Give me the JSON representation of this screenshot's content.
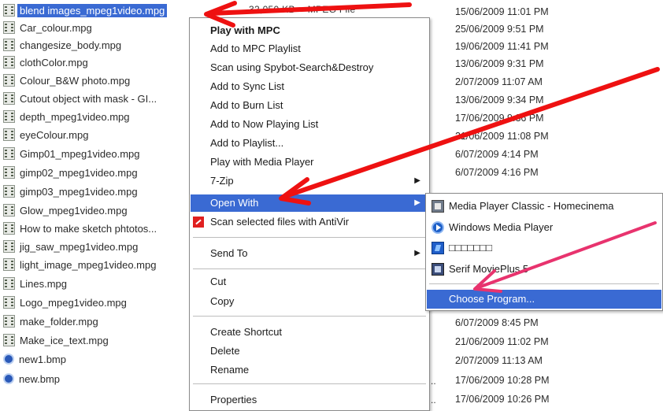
{
  "files": [
    {
      "name": "blend images_mpeg1video.mpg",
      "type": "mpg",
      "selected": true
    },
    {
      "name": "Car_colour.mpg",
      "type": "mpg"
    },
    {
      "name": "changesize_body.mpg",
      "type": "mpg"
    },
    {
      "name": "clothColor.mpg",
      "type": "mpg"
    },
    {
      "name": "Colour_B&W photo.mpg",
      "type": "mpg"
    },
    {
      "name": "Cutout object with mask - GI...",
      "type": "mpg"
    },
    {
      "name": "depth_mpeg1video.mpg",
      "type": "mpg"
    },
    {
      "name": "eyeColour.mpg",
      "type": "mpg"
    },
    {
      "name": "Gimp01_mpeg1video.mpg",
      "type": "mpg"
    },
    {
      "name": "gimp02_mpeg1video.mpg",
      "type": "mpg"
    },
    {
      "name": "gimp03_mpeg1video.mpg",
      "type": "mpg"
    },
    {
      "name": "Glow_mpeg1video.mpg",
      "type": "mpg"
    },
    {
      "name": "How to make  sketch phtotos...",
      "type": "mpg"
    },
    {
      "name": "jig_saw_mpeg1video.mpg",
      "type": "mpg"
    },
    {
      "name": "light_image_mpeg1video.mpg",
      "type": "mpg"
    },
    {
      "name": "Lines.mpg",
      "type": "mpg"
    },
    {
      "name": "Logo_mpeg1video.mpg",
      "type": "mpg"
    },
    {
      "name": "make_folder.mpg",
      "type": "mpg"
    },
    {
      "name": "Make_ice_text.mpg",
      "type": "mpg"
    },
    {
      "name": "new1.bmp",
      "type": "bmp"
    },
    {
      "name": "new.bmp",
      "type": "bmp"
    }
  ],
  "selected_size": "32,050 KB",
  "selected_type": "MPEG File",
  "dates": [
    "15/06/2009 11:01 PM",
    "25/06/2009 9:51 PM",
    "19/06/2009 11:41 PM",
    "13/06/2009 9:31 PM",
    "2/07/2009 11:07 AM",
    "13/06/2009 9:34 PM",
    "17/06/2009 9:36 PM",
    "21/06/2009 11:08 PM",
    "6/07/2009 4:14 PM",
    "6/07/2009 4:16 PM",
    "6/07/2009 8:45 PM",
    "21/06/2009 11:02 PM",
    "2/07/2009 11:13 AM",
    "17/06/2009 10:28 PM",
    "17/06/2009 10:26 PM"
  ],
  "ellipsis": "..",
  "context_menu": {
    "items": [
      {
        "label": "Play with MPC",
        "bold": true
      },
      {
        "label": "Add to MPC Playlist"
      },
      {
        "label": "Scan using Spybot-Search&Destroy"
      },
      {
        "label": "Add to Sync List"
      },
      {
        "label": "Add to Burn List"
      },
      {
        "label": "Add to Now Playing List"
      },
      {
        "label": "Add to Playlist..."
      },
      {
        "label": "Play with Media Player"
      },
      {
        "label": "7-Zip",
        "submenu": true
      },
      {
        "label": "Open With",
        "submenu": true,
        "highlighted": true
      },
      {
        "label": "Scan selected files with AntiVir",
        "icon": "antivir-icon"
      },
      {
        "label": "Send To",
        "submenu": true
      },
      {
        "label": "Cut"
      },
      {
        "label": "Copy"
      },
      {
        "label": "Create Shortcut"
      },
      {
        "label": "Delete"
      },
      {
        "label": "Rename"
      },
      {
        "label": "Properties"
      }
    ],
    "arrow_glyph": "▶"
  },
  "open_with_submenu": {
    "items": [
      {
        "label": "Media Player Classic - Homecinema",
        "icon": "mpc-icon"
      },
      {
        "label": "Windows Media Player",
        "icon": "windows-media-player-icon"
      },
      {
        "label": "□□□□□□□",
        "icon": "program-icon"
      },
      {
        "label": "Serif MoviePlus 5",
        "icon": "serif-movieplus-icon"
      },
      {
        "label": "Choose Program...",
        "highlighted": true
      }
    ]
  },
  "colors": {
    "selection": "#3a6ad3",
    "annotation_red": "#ee1111",
    "annotation_pink": "#e8336e"
  }
}
